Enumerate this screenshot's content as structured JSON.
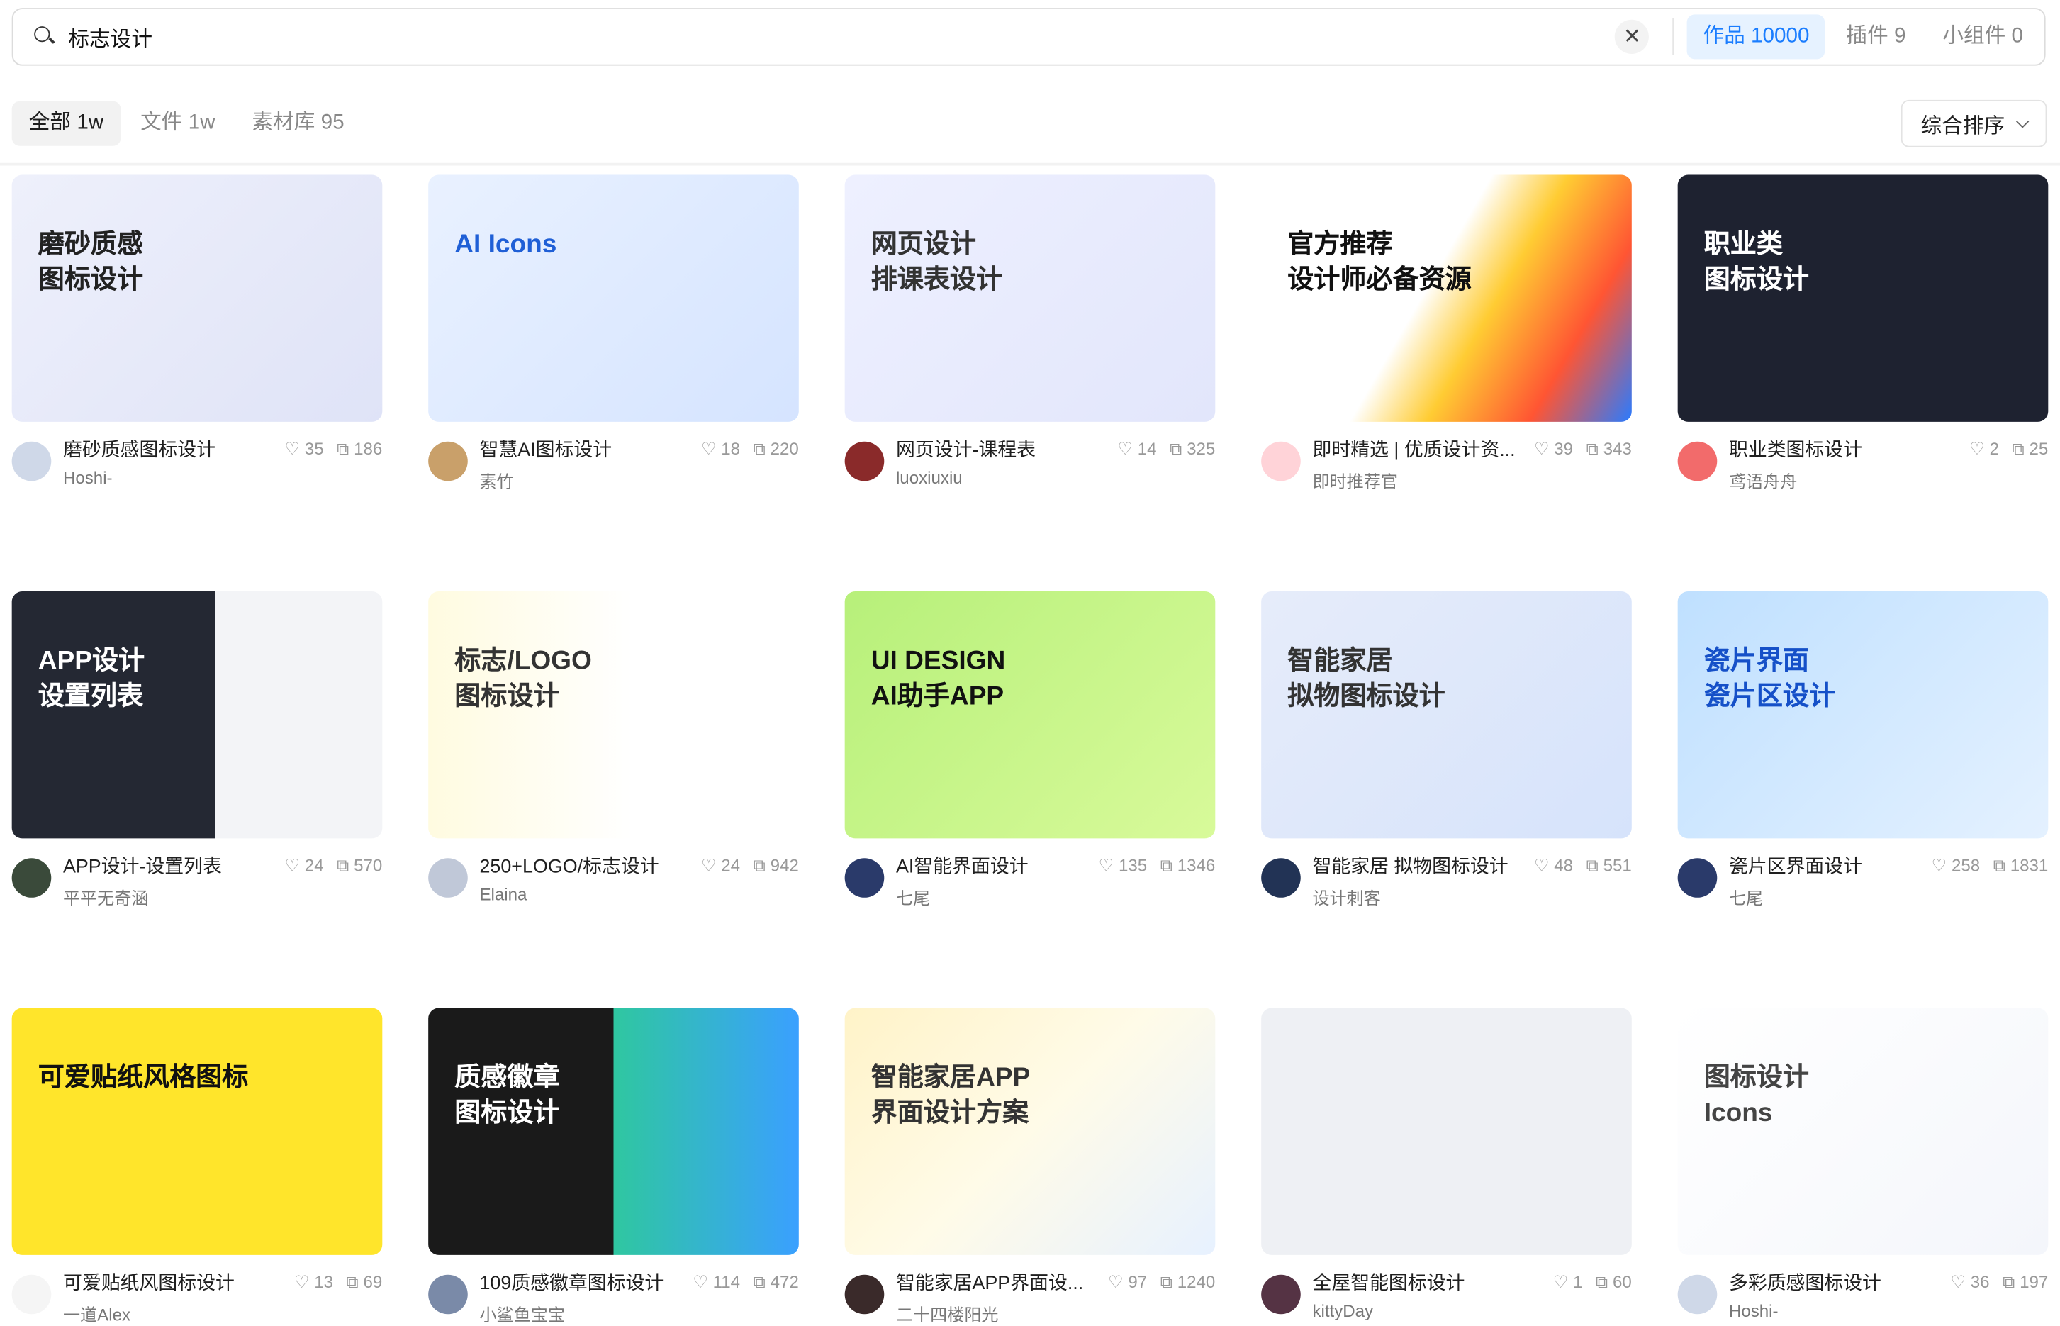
{
  "search": {
    "value": "标志设计",
    "clear_icon": "close-icon",
    "tabs": [
      {
        "label": "作品 10000",
        "active": true
      },
      {
        "label": "插件 9"
      },
      {
        "label": "小组件 0"
      }
    ]
  },
  "filters": {
    "tabs": [
      {
        "label": "全部 1w",
        "active": true
      },
      {
        "label": "文件 1w"
      },
      {
        "label": "素材库 95"
      }
    ],
    "sort": "综合排序"
  },
  "accent": "#1a7dff",
  "cards": [
    {
      "title": "磨砂质感图标设计",
      "author": "Hoshi-",
      "likes": "35",
      "views": "186",
      "thumb": "磨砂质感\n图标设计",
      "bg": "linear-gradient(135deg,#eef0fb,#dfe3f7)",
      "fg": "#222",
      "av": "#cfd8e8"
    },
    {
      "title": "智慧AI图标设计",
      "author": "素竹",
      "likes": "18",
      "views": "220",
      "thumb": "AI Icons",
      "bg": "linear-gradient(135deg,#e9f1ff,#d5e4ff)",
      "fg": "#1f5fd6",
      "av": "#c9a06a"
    },
    {
      "title": "网页设计-课程表",
      "author": "luoxiuxiu",
      "likes": "14",
      "views": "325",
      "thumb": "网页设计\n排课表设计",
      "bg": "linear-gradient(135deg,#eef0ff,#e2e6fb)",
      "fg": "#333",
      "av": "#8a2a2a"
    },
    {
      "title": "即时精选 | 优质设计资...",
      "author": "即时推荐官",
      "likes": "39",
      "views": "343",
      "thumb": "官方推荐\n设计师必备资源",
      "bg": "linear-gradient(120deg,#fff 45%,#ffcc33 60%,#ff5533 80%,#2a7bff)",
      "fg": "#111",
      "av": "#ffd3d8"
    },
    {
      "title": "职业类图标设计",
      "author": "鸢语舟舟",
      "likes": "2",
      "views": "25",
      "thumb": "职业类\n图标设计",
      "bg": "#1e2230",
      "fg": "#fff",
      "av": "#f26b6b"
    },
    {
      "title": "APP设计-设置列表",
      "author": "平平无奇涵",
      "likes": "24",
      "views": "570",
      "thumb": "APP设计\n设置列表",
      "bg": "linear-gradient(90deg,#242833 55%,#f3f4f7 55%)",
      "fg": "#fff",
      "av": "#3a4a3a"
    },
    {
      "title": "250+LOGO/标志设计",
      "author": "Elaina",
      "likes": "24",
      "views": "942",
      "thumb": "标志/LOGO\n图标设计",
      "bg": "linear-gradient(90deg,#fffbe0,#fff 55%)",
      "fg": "#333",
      "av": "#c0c8d8"
    },
    {
      "title": "AI智能界面设计",
      "author": "七尾",
      "likes": "135",
      "views": "1346",
      "thumb": "UI DESIGN\nAI助手APP",
      "bg": "linear-gradient(135deg,#b7f07a,#d8fa9a)",
      "fg": "#111",
      "av": "#2a3a6a"
    },
    {
      "title": "智能家居 拟物图标设计",
      "author": "设计刺客",
      "likes": "48",
      "views": "551",
      "thumb": "智能家居\n拟物图标设计",
      "bg": "linear-gradient(135deg,#e6ecfa,#d6e3fb)",
      "fg": "#333",
      "av": "#223355"
    },
    {
      "title": "瓷片区界面设计",
      "author": "七尾",
      "likes": "258",
      "views": "1831",
      "thumb": "瓷片界面\n瓷片区设计",
      "bg": "linear-gradient(135deg,#bfe0ff,#e4f1ff)",
      "fg": "#1550c8",
      "av": "#2a3a6a"
    },
    {
      "title": "可爱贴纸风图标设计",
      "author": "一道Alex",
      "likes": "13",
      "views": "69",
      "thumb": "可爱贴纸风格图标",
      "bg": "#ffe52b",
      "fg": "#111",
      "av": "#f5f5f5"
    },
    {
      "title": "109质感徽章图标设计",
      "author": "小鲨鱼宝宝",
      "likes": "114",
      "views": "472",
      "thumb": "质感徽章\n图标设计",
      "bg": "linear-gradient(90deg,#1a1a1a 50%,#2fc7a0 50%,#3aa0ff)",
      "fg": "#fff",
      "av": "#7a8aa8"
    },
    {
      "title": "智能家居APP界面设...",
      "author": "二十四楼阳光",
      "likes": "97",
      "views": "1240",
      "thumb": "智能家居APP\n界面设计方案",
      "bg": "linear-gradient(135deg,#fff3c8,#fffbe8 50%,#e7f1ff)",
      "fg": "#333",
      "av": "#3a2a2a"
    },
    {
      "title": "全屋智能图标设计",
      "author": "kittyDay",
      "likes": "1",
      "views": "60",
      "thumb": "",
      "bg": "#eef0f4",
      "fg": "#e33",
      "av": "#553344"
    },
    {
      "title": "多彩质感图标设计",
      "author": "Hoshi-",
      "likes": "36",
      "views": "197",
      "thumb": "图标设计\nIcons",
      "bg": "linear-gradient(135deg,#fff,#f4f6fb)",
      "fg": "#444",
      "av": "#cfd8e8"
    }
  ]
}
